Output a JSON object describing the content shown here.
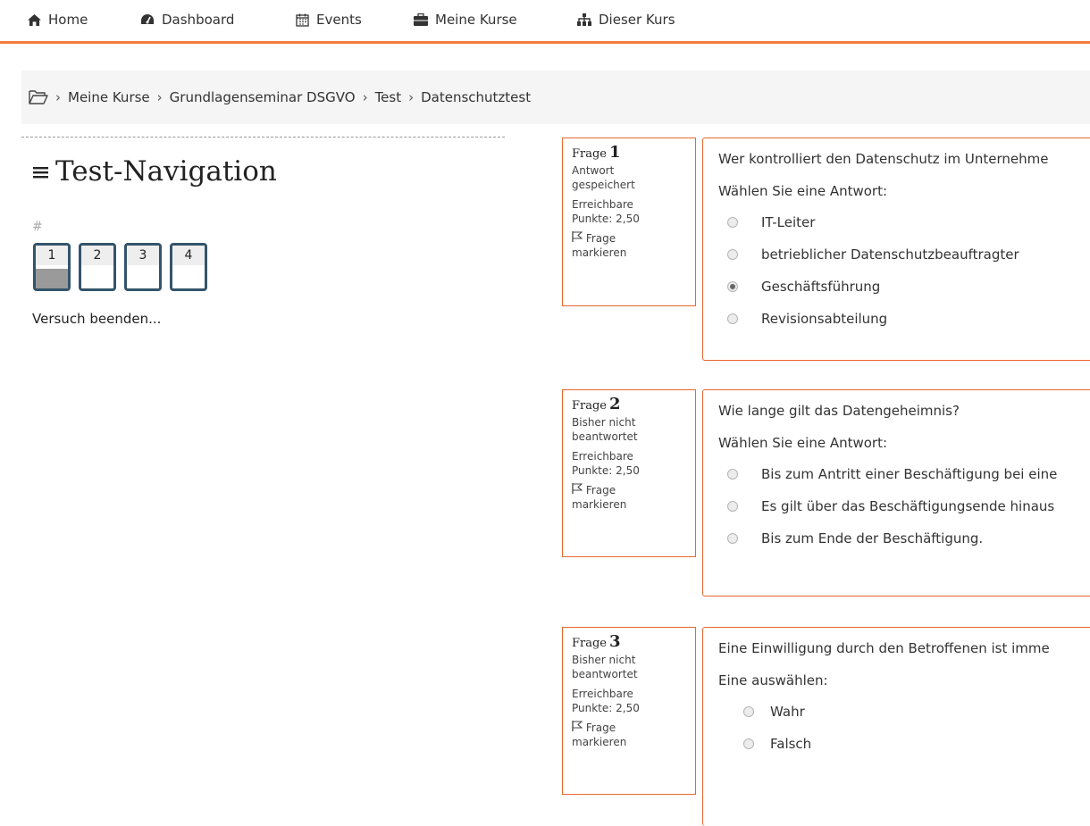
{
  "nav": {
    "home": "Home",
    "dashboard": "Dashboard",
    "events": "Events",
    "my_courses": "Meine Kurse",
    "this_course": "Dieser Kurs"
  },
  "breadcrumb": {
    "items": [
      "Meine Kurse",
      "Grundlagenseminar DSGVO",
      "Test",
      "Datenschutztest"
    ]
  },
  "quiz_nav": {
    "title": "Test-Navigation",
    "hash": "#",
    "buttons": [
      "1",
      "2",
      "3",
      "4"
    ],
    "finish": "Versuch beenden..."
  },
  "questions": [
    {
      "label": "Frage",
      "number": "1",
      "status_1": "Antwort",
      "status_2": "gespeichert",
      "points_1": "Erreichbare",
      "points_2": "Punkte: 2,50",
      "flag_1": "Frage",
      "flag_2": "markieren",
      "text": "Wer kontrolliert den Datenschutz im Unternehme",
      "prompt": "Wählen Sie eine Antwort:",
      "options": [
        "IT-Leiter",
        "betrieblicher Datenschutzbeauftragter",
        "Geschäftsführung",
        "Revisionsabteilung"
      ],
      "selected": "Geschäftsführung"
    },
    {
      "label": "Frage",
      "number": "2",
      "status_1": "Bisher nicht",
      "status_2": "beantwortet",
      "points_1": "Erreichbare",
      "points_2": "Punkte: 2,50",
      "flag_1": "Frage",
      "flag_2": "markieren",
      "text": "Wie lange gilt das Datengeheimnis?",
      "prompt": "Wählen Sie eine Antwort:",
      "options": [
        "Bis zum Antritt einer Beschäftigung bei eine",
        "Es gilt über das Beschäftigungsende hinaus",
        "Bis zum Ende der Beschäftigung."
      ],
      "selected": ""
    },
    {
      "label": "Frage",
      "number": "3",
      "status_1": "Bisher nicht",
      "status_2": "beantwortet",
      "points_1": "Erreichbare",
      "points_2": "Punkte: 2,50",
      "flag_1": "Frage",
      "flag_2": "markieren",
      "text": "Eine Einwilligung durch den Betroffenen ist imme",
      "prompt": "Eine auswählen:",
      "options": [
        "Wahr",
        "Falsch"
      ],
      "selected": ""
    }
  ],
  "colors": {
    "accent": "#f47c3c",
    "box_border": "#e8672e",
    "nav_button_border": "#34546a"
  }
}
